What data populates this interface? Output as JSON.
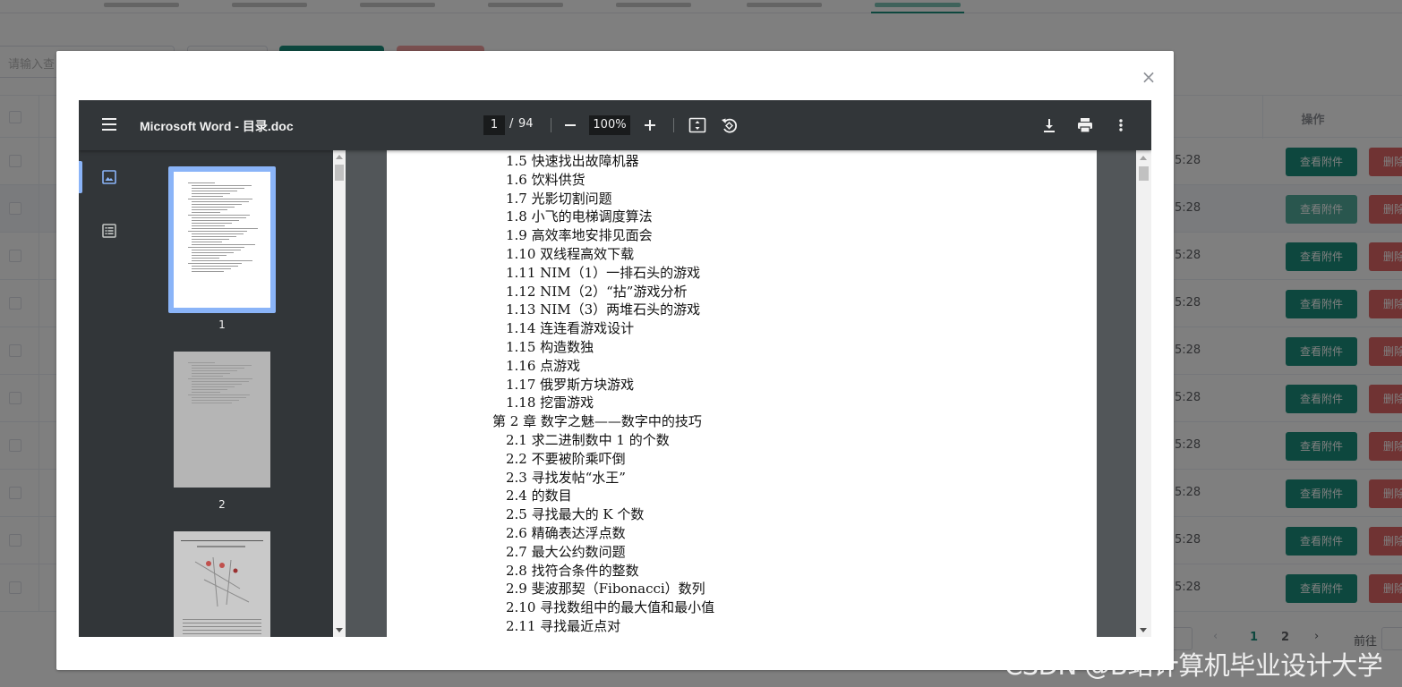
{
  "background": {
    "search_placeholder": "请输入查",
    "table_header_ops": "操作",
    "row_time": "5:28",
    "view_button": "查看附件",
    "delete_button": "删除",
    "pagination": {
      "current": "1",
      "next_page": "2",
      "prev": "‹",
      "next": "›",
      "goto": "前往"
    }
  },
  "dialog": {
    "close": "×"
  },
  "viewer": {
    "title": "Microsoft Word - 目录.doc",
    "page_current": "1",
    "page_separator": "/",
    "page_total": "94",
    "zoom": "100%",
    "icons": [
      "menu-icon",
      "zoom-out-icon",
      "zoom-in-icon",
      "fit-page-icon",
      "rotate-icon",
      "download-icon",
      "print-icon",
      "more-icon",
      "thumbnails-icon",
      "outline-icon"
    ],
    "thumbnails": [
      {
        "label": "1"
      },
      {
        "label": "2"
      }
    ],
    "toc": [
      {
        "text": "1.5 快速找出故障机器",
        "level": 2
      },
      {
        "text": "1.6 饮料供货",
        "level": 2
      },
      {
        "text": "1.7 光影切割问题",
        "level": 2
      },
      {
        "text": "1.8 小飞的电梯调度算法",
        "level": 2
      },
      {
        "text": "1.9 高效率地安排见面会",
        "level": 2
      },
      {
        "text": "1.10 双线程高效下载",
        "level": 2
      },
      {
        "text": "1.11 NIM（1）一排石头的游戏",
        "level": 2
      },
      {
        "text": "1.12 NIM（2）“拈”游戏分析",
        "level": 2
      },
      {
        "text": "1.13 NIM（3）两堆石头的游戏",
        "level": 2
      },
      {
        "text": "1.14 连连看游戏设计",
        "level": 2
      },
      {
        "text": "1.15 构造数独",
        "level": 2
      },
      {
        "text": "1.16 点游戏",
        "level": 2
      },
      {
        "text": "1.17 俄罗斯方块游戏",
        "level": 2
      },
      {
        "text": "1.18 挖雷游戏",
        "level": 2
      },
      {
        "text": "第 2 章  数字之魅——数字中的技巧",
        "level": 1
      },
      {
        "text": "2.1 求二进制数中 1 的个数",
        "level": 2
      },
      {
        "text": "2.2 不要被阶乘吓倒",
        "level": 2
      },
      {
        "text": "2.3 寻找发帖“水王”",
        "level": 2
      },
      {
        "text": "2.4 的数目",
        "level": 2
      },
      {
        "text": "2.5 寻找最大的 K 个数",
        "level": 2
      },
      {
        "text": "2.6 精确表达浮点数",
        "level": 2
      },
      {
        "text": "2.7 最大公约数问题",
        "level": 2
      },
      {
        "text": "2.8 找符合条件的整数",
        "level": 2
      },
      {
        "text": "2.9 斐波那契（Fibonacci）数列",
        "level": 2
      },
      {
        "text": "2.10 寻找数组中的最大值和最小值",
        "level": 2
      },
      {
        "text": "2.11 寻找最近点对",
        "level": 2
      }
    ]
  },
  "watermark": "CSDN @B站计算机毕业设计大学",
  "colors": {
    "accent": "#1a8f7c",
    "danger": "#e06666",
    "viewer_toolbar": "#323639",
    "viewer_bg": "#525659",
    "thumb_selected": "#8ab4f8"
  }
}
